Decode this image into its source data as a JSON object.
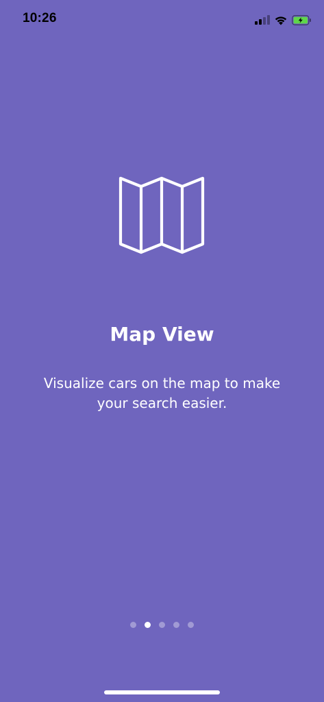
{
  "status_bar": {
    "time": "10:26",
    "signal_icon": "cellular-signal-icon",
    "wifi_icon": "wifi-icon",
    "battery_icon": "battery-charging-icon"
  },
  "slide": {
    "icon": "map-icon",
    "title": "Map View",
    "description": "Visualize cars on the map to make your search easier."
  },
  "pager": {
    "total": 5,
    "active_index": 1
  },
  "colors": {
    "background": "#6f65be",
    "text": "#ffffff",
    "battery_fill": "#5fd64a"
  }
}
